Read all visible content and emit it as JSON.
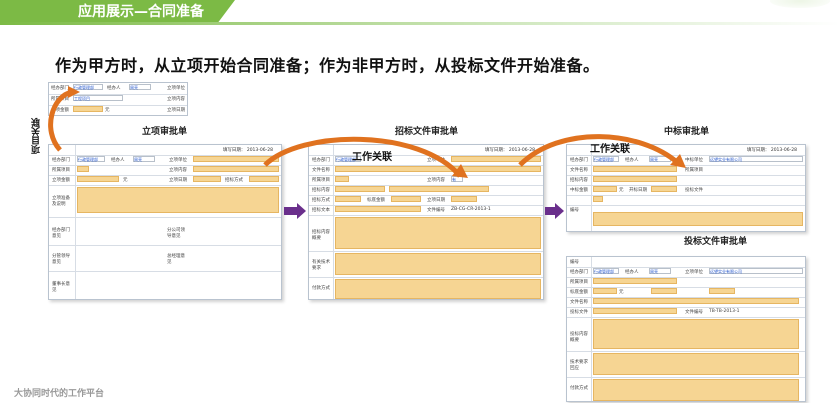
{
  "slide": {
    "section_title": "应用展示—合同准备",
    "heading": "作为甲方时，从立项开始合同准备；作为非甲方时，从投标文件开始准备。",
    "footer": "大协同时代的工作平台"
  },
  "forms": {
    "lixiang": {
      "caption": "立项审批单",
      "date": "填写日期： 2013-06-28"
    },
    "zhaobiao": {
      "caption": "招标文件审批单",
      "date": "填写日期： 2013-06-28"
    },
    "zhongbiao": {
      "caption": "中标审批单",
      "date": "填写日期： 2013-06-28"
    },
    "toubiao": {
      "caption": "投标文件审批单"
    }
  },
  "annotations": {
    "work_link_1": "工作关联",
    "work_link_2": "工作关联",
    "project_link": "项目关联"
  },
  "mini_form": {
    "labels": [
      "经办部门",
      "经办人",
      "立项单位",
      "所属项目",
      "立项内容",
      "立项金额",
      "立项日期"
    ],
    "dept_value": "行政管理部",
    "person_value": "周亮",
    "project_value": "工程项目",
    "amount_unit": "元"
  },
  "field_labels": {
    "dept": "经办部门",
    "person": "经办人",
    "unit": "立项单位",
    "project": "所属项目",
    "content": "立项内容",
    "amount": "立项金额",
    "date": "立项日期",
    "tender_method": "招标方式",
    "prep": "立项准备及说明",
    "dept_opinion": "经办部门意见",
    "manager_opinion": "分管领导意见",
    "chairman_opinion": "董事长意见",
    "co_dept_opinion": "分公司领导意见",
    "gm_opinion": "总经理意见",
    "file_name": "文件名称",
    "bid_content": "招标内容",
    "bid_amount": "标底金额",
    "bid_doc": "招标文本",
    "doc_no": "文件编号",
    "doc_no_value": "ZB-CG-CR-2013-1",
    "bid_summary": "招标内容概要",
    "tech_req": "有关技术要求",
    "payment": "付款方式",
    "win_unit": "中标单位",
    "win_amount": "中标金额",
    "win_date": "开标日期",
    "bid_file": "投标文件",
    "no": "编号",
    "company_value": "远望实业有限公司",
    "toubiao_doc_no": "TB-TB-2013-1",
    "toubiao_summary": "投标内容概要",
    "tech_resp": "技术要求回应",
    "yuan": "元",
    "you": "有"
  }
}
